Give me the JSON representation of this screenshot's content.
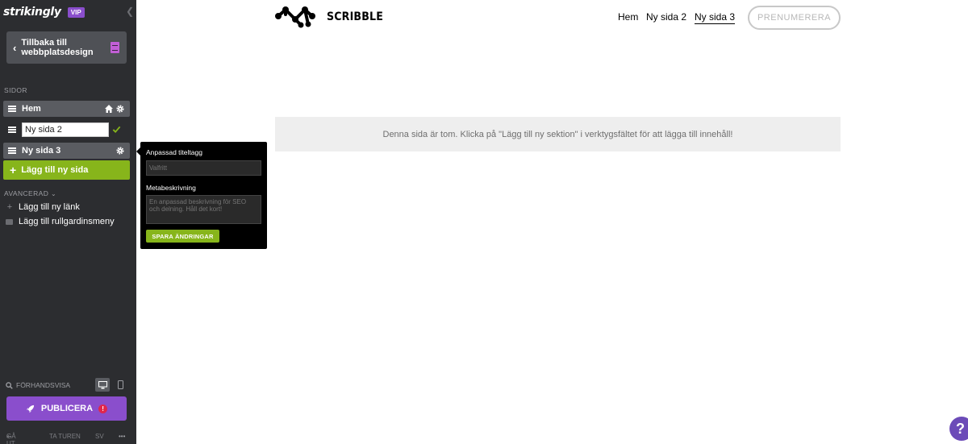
{
  "sidebar": {
    "logo": "strikingly",
    "badge": "VIP",
    "back_label": "Tillbaka till webbplatsdesign",
    "back_line1": "Tillbaka till",
    "back_line2": "webbplatsdesign",
    "pages_heading": "SIDOR",
    "pages": [
      {
        "label": "Hem",
        "icons": [
          "home-icon",
          "gear-icon"
        ]
      },
      {
        "label": "Ny sida 2",
        "editing": true
      },
      {
        "label": "Ny sida 3",
        "icons": [
          "gear-icon"
        ]
      }
    ],
    "add_page_label": "Lägg till ny sida",
    "advanced_heading": "AVANCERAD",
    "advanced_items": [
      {
        "label": "Lägg till ny länk",
        "icon": "plus-icon"
      },
      {
        "label": "Lägg till rullgardinsmeny",
        "icon": "folder-icon"
      }
    ],
    "preview_label": "FÖRHANDSVISA",
    "publish_label": "PUBLICERA",
    "footer": {
      "logout": "GÅ UT",
      "tour": "TA TUREN",
      "lang": "SV",
      "more": "•••"
    }
  },
  "popover": {
    "title_label": "Anpassad titeltagg",
    "title_placeholder": "Valfritt",
    "meta_label": "Metabeskrivning",
    "meta_placeholder": "En anpassad beskrivning för SEO och delning. Håll det kort!",
    "save_label": "SPARA ÄNDRINGAR"
  },
  "site": {
    "brand": "SCRIBBLE",
    "nav": [
      "Hem",
      "Ny sida 2",
      "Ny sida 3"
    ],
    "active_nav": "Ny sida 3",
    "subscribe_label": "PRENUMERERA",
    "empty_message": "Denna sida är tom. Klicka på \"Lägg till ny sektion\" i verktygsfältet för att lägga till innehåll!"
  },
  "help_label": "?",
  "colors": {
    "sidebar_bg": "#2c2d30",
    "accent_green": "#87b51b",
    "accent_purple": "#8a4ecc",
    "warning_red": "#e1264b"
  }
}
